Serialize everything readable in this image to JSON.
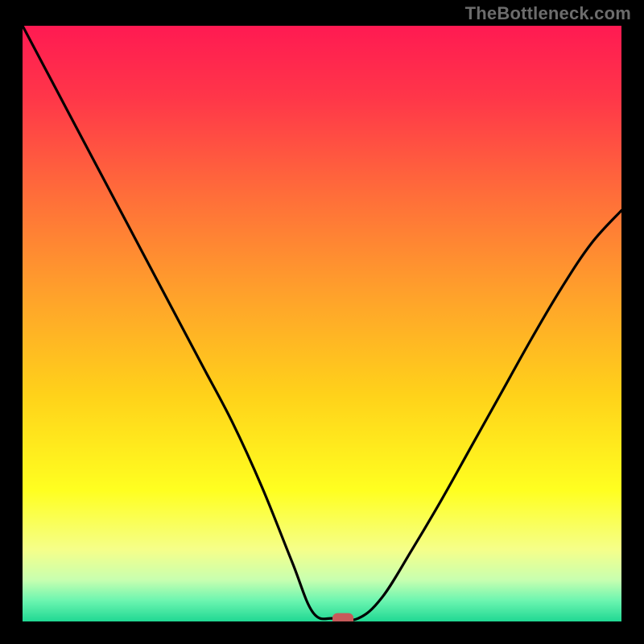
{
  "watermark": "TheBottleneck.com",
  "chart_data": {
    "type": "line",
    "title": "",
    "xlabel": "",
    "ylabel": "",
    "xlim": [
      0,
      1
    ],
    "ylim": [
      0,
      1
    ],
    "legend": false,
    "grid": false,
    "background": {
      "type": "vertical-gradient",
      "stops": [
        {
          "offset": 0.0,
          "color": "#ff1a52"
        },
        {
          "offset": 0.12,
          "color": "#ff3649"
        },
        {
          "offset": 0.28,
          "color": "#ff6c3a"
        },
        {
          "offset": 0.45,
          "color": "#ffa12b"
        },
        {
          "offset": 0.62,
          "color": "#ffd21a"
        },
        {
          "offset": 0.78,
          "color": "#ffff20"
        },
        {
          "offset": 0.88,
          "color": "#f5ff8a"
        },
        {
          "offset": 0.93,
          "color": "#c8ffb0"
        },
        {
          "offset": 0.965,
          "color": "#6cf5b0"
        },
        {
          "offset": 1.0,
          "color": "#20d893"
        }
      ]
    },
    "series": [
      {
        "name": "bottleneck-curve",
        "stroke": "#000000",
        "x": [
          0.0,
          0.05,
          0.1,
          0.15,
          0.2,
          0.25,
          0.3,
          0.35,
          0.4,
          0.45,
          0.485,
          0.52,
          0.56,
          0.6,
          0.65,
          0.7,
          0.75,
          0.8,
          0.85,
          0.9,
          0.95,
          1.0
        ],
        "y": [
          1.0,
          0.905,
          0.81,
          0.715,
          0.62,
          0.525,
          0.43,
          0.335,
          0.225,
          0.1,
          0.015,
          0.005,
          0.005,
          0.04,
          0.12,
          0.205,
          0.295,
          0.385,
          0.475,
          0.56,
          0.635,
          0.69
        ]
      }
    ],
    "marker": {
      "name": "min-marker",
      "x": 0.535,
      "y": 0.003,
      "shape": "rounded-rect",
      "w_frac": 0.035,
      "h_frac": 0.022,
      "fill": "#c65a5a"
    }
  }
}
